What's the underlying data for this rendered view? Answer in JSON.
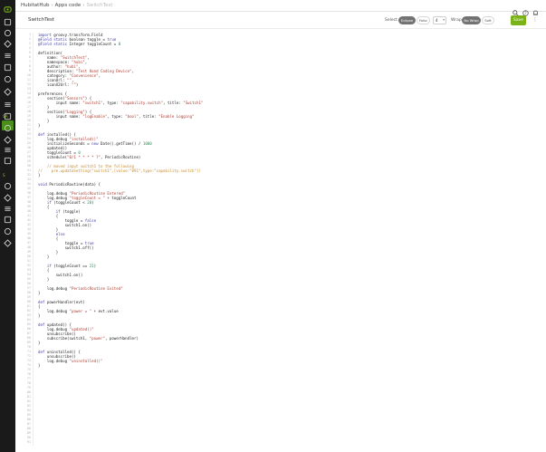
{
  "app": {
    "breadcrumbs": [
      "HubitatHub",
      "Apps code",
      "SwitchTest"
    ]
  },
  "colors": {
    "accent_green": "#7ab317",
    "rail_bg": "#1a1a1a",
    "rail_highlight": "#4a8f1a",
    "keyword": "#3b3ba8",
    "string": "#b03a2e",
    "number": "#2e8a57",
    "comment": "#c98a2a"
  },
  "rail": {
    "sections": [
      "SA",
      "S"
    ],
    "icons": [
      "logo-icon",
      "home-icon",
      "devices-icon",
      "location-icon",
      "gear-icon",
      "clock-icon",
      "bulb-icon",
      "menu-icon",
      "apps-icon",
      "shield-icon",
      "gear-icon",
      "tools-icon",
      "gear-icon",
      "list-icon",
      "chat-icon",
      "link-icon",
      "settings-icon",
      "transfer-icon",
      "box-icon",
      "globe-icon"
    ]
  },
  "toolbar": {
    "file_title": "SwitchTest",
    "select_label": "Select",
    "select_options": [
      "Eclipse",
      "Falsc"
    ],
    "font_size": "4",
    "wrap_label": "Wrap",
    "wrap_options": [
      "No Wrap",
      "Soft"
    ],
    "save_label": "Save",
    "more_glyph": "⋮"
  },
  "editor": {
    "line_count": 91,
    "lines": [
      [
        [
          "k",
          "import "
        ],
        [
          "t",
          "groovy.transform.Field"
        ]
      ],
      [
        [
          "k",
          "@Field static "
        ],
        [
          "t",
          "boolean toggle = "
        ],
        [
          "k",
          "true"
        ]
      ],
      [
        [
          "k",
          "@Field static "
        ],
        [
          "t",
          "Integer toggleCount = "
        ],
        [
          "n",
          "0"
        ]
      ],
      [],
      [
        [
          "t",
          "definition("
        ]
      ],
      [
        [
          "t",
          "    name: "
        ],
        [
          "s",
          "\"SwitchTest\""
        ],
        [
          "t",
          ","
        ]
      ],
      [
        [
          "t",
          "    namespace: "
        ],
        [
          "s",
          "\"hubi\""
        ],
        [
          "t",
          ","
        ]
      ],
      [
        [
          "t",
          "    author: "
        ],
        [
          "s",
          "\"hubi\""
        ],
        [
          "t",
          ","
        ]
      ],
      [
        [
          "t",
          "    description: "
        ],
        [
          "s",
          "\"Test Hand Coding Device\""
        ],
        [
          "t",
          ","
        ]
      ],
      [
        [
          "t",
          "    category: "
        ],
        [
          "s",
          "\"Convenience\""
        ],
        [
          "t",
          ","
        ]
      ],
      [
        [
          "t",
          "    iconUrl: "
        ],
        [
          "s",
          "\"\""
        ],
        [
          "t",
          ","
        ]
      ],
      [
        [
          "t",
          "    iconX2Url: "
        ],
        [
          "s",
          "\"\""
        ],
        [
          "t",
          ")"
        ]
      ],
      [],
      [
        [
          "t",
          "preferences {"
        ]
      ],
      [
        [
          "t",
          "    section("
        ],
        [
          "s",
          "\"Sensors\""
        ],
        [
          "t",
          ") {"
        ]
      ],
      [
        [
          "t",
          "        input name: "
        ],
        [
          "s",
          "\"switch1\""
        ],
        [
          "t",
          ", type: "
        ],
        [
          "s",
          "\"capability.switch\""
        ],
        [
          "t",
          ", title: "
        ],
        [
          "s",
          "\"Switch1\""
        ]
      ],
      [
        [
          "t",
          "    }"
        ]
      ],
      [
        [
          "t",
          "    section("
        ],
        [
          "s",
          "\"Logging\""
        ],
        [
          "t",
          ") {"
        ]
      ],
      [
        [
          "t",
          "        input name: "
        ],
        [
          "s",
          "\"logEnable\""
        ],
        [
          "t",
          ", type: "
        ],
        [
          "s",
          "\"bool\""
        ],
        [
          "t",
          ", title: "
        ],
        [
          "s",
          "\"Enable Logging\""
        ]
      ],
      [
        [
          "t",
          "    }"
        ]
      ],
      [
        [
          "t",
          "}"
        ]
      ],
      [],
      [
        [
          "k",
          "def "
        ],
        [
          "t",
          "installed() {"
        ]
      ],
      [
        [
          "t",
          "    log.debug "
        ],
        [
          "s",
          "\"installed()\""
        ]
      ],
      [
        [
          "t",
          "    initializeSeconds = "
        ],
        [
          "k",
          "new "
        ],
        [
          "t",
          "Date().getTime() / "
        ],
        [
          "n",
          "1000"
        ]
      ],
      [
        [
          "t",
          "    updated()"
        ]
      ],
      [
        [
          "t",
          "    toggleCount = "
        ],
        [
          "n",
          "0"
        ]
      ],
      [
        [
          "t",
          "    schedule("
        ],
        [
          "s",
          "\"0/1 * * * * ?\""
        ],
        [
          "t",
          ", PeriodicRoutine)"
        ]
      ],
      [],
      [
        [
          "c",
          "    // moved input switch1 to the following"
        ]
      ],
      [
        [
          "c",
          "//    pre.updateSetting(\"switch1\",[value:\"891\",type:\"capability.switch\"])"
        ]
      ],
      [
        [
          "t",
          "}"
        ]
      ],
      [],
      [
        [
          "k",
          "void "
        ],
        [
          "t",
          "PeriodicRoutine(data) {"
        ]
      ],
      [],
      [
        [
          "t",
          "    log.debug "
        ],
        [
          "s",
          "\"PeriodicRoutine Entered\""
        ]
      ],
      [
        [
          "t",
          "    log.debug "
        ],
        [
          "s",
          "\"toggleCount = \""
        ],
        [
          "t",
          " + toggleCount"
        ]
      ],
      [
        [
          "t",
          "    "
        ],
        [
          "k",
          "if "
        ],
        [
          "t",
          "(toggleCount < "
        ],
        [
          "n",
          "20"
        ],
        [
          "t",
          ")"
        ]
      ],
      [
        [
          "t",
          "    {"
        ]
      ],
      [
        [
          "t",
          "        "
        ],
        [
          "k",
          "if "
        ],
        [
          "t",
          "(toggle)"
        ]
      ],
      [
        [
          "t",
          "        {"
        ]
      ],
      [
        [
          "t",
          "            toggle = "
        ],
        [
          "k",
          "false"
        ]
      ],
      [
        [
          "t",
          "            switch1.on()"
        ]
      ],
      [
        [
          "t",
          "        }"
        ]
      ],
      [
        [
          "t",
          "        "
        ],
        [
          "k",
          "else"
        ]
      ],
      [
        [
          "t",
          "        {"
        ]
      ],
      [
        [
          "t",
          "            toggle = "
        ],
        [
          "k",
          "true"
        ]
      ],
      [
        [
          "t",
          "            switch1.off()"
        ]
      ],
      [
        [
          "t",
          "        }"
        ]
      ],
      [
        [
          "t",
          "    }"
        ]
      ],
      [],
      [
        [
          "t",
          "    "
        ],
        [
          "k",
          "if "
        ],
        [
          "t",
          "(toggleCount == "
        ],
        [
          "n",
          "21"
        ],
        [
          "t",
          ")"
        ]
      ],
      [
        [
          "t",
          "    {"
        ]
      ],
      [
        [
          "t",
          "        switch1.on()"
        ]
      ],
      [
        [
          "t",
          "    }"
        ]
      ],
      [],
      [
        [
          "t",
          "    log.debug "
        ],
        [
          "s",
          "\"PeriodicRoutine Exited\""
        ]
      ],
      [
        [
          "t",
          "}"
        ]
      ],
      [],
      [
        [
          "k",
          "def "
        ],
        [
          "t",
          "powerHandler(evt)"
        ]
      ],
      [
        [
          "t",
          "{"
        ]
      ],
      [
        [
          "t",
          "    log.debug "
        ],
        [
          "s",
          "\"power = \""
        ],
        [
          "t",
          " + evt.value"
        ]
      ],
      [
        [
          "t",
          "}"
        ]
      ],
      [],
      [
        [
          "k",
          "def "
        ],
        [
          "t",
          "updated() {"
        ]
      ],
      [
        [
          "t",
          "    log.debug "
        ],
        [
          "s",
          "\"updated()\""
        ]
      ],
      [
        [
          "t",
          "    unsubscribe()"
        ]
      ],
      [
        [
          "t",
          "    subscribe(switch1, "
        ],
        [
          "s",
          "\"power\""
        ],
        [
          "t",
          ", powerHandler)"
        ]
      ],
      [
        [
          "t",
          "}"
        ]
      ],
      [],
      [
        [
          "k",
          "def "
        ],
        [
          "t",
          "uninstalled() {"
        ]
      ],
      [
        [
          "t",
          "    unsubscribe()"
        ]
      ],
      [
        [
          "t",
          "    log.debug "
        ],
        [
          "s",
          "\"uninstalled()\""
        ]
      ],
      [
        [
          "t",
          "}"
        ]
      ]
    ]
  }
}
